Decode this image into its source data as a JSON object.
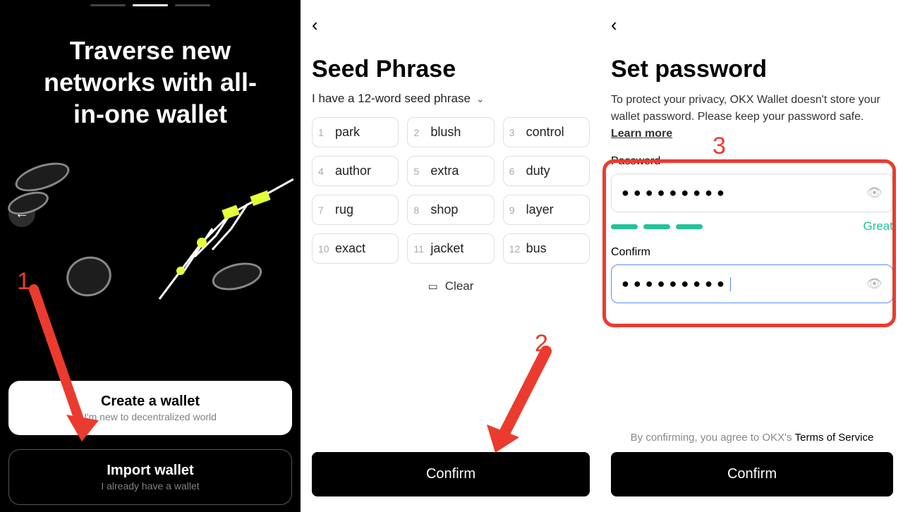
{
  "panel1": {
    "heading": "Traverse new networks with all-in-one wallet",
    "create_title": "Create a wallet",
    "create_sub": "I'm new to decentralized world",
    "import_title": "Import wallet",
    "import_sub": "I already have a wallet",
    "annotation_num": "1"
  },
  "panel2": {
    "title": "Seed Phrase",
    "selector": "I have a 12-word seed phrase",
    "words": [
      "park",
      "blush",
      "control",
      "author",
      "extra",
      "duty",
      "rug",
      "shop",
      "layer",
      "exact",
      "jacket",
      "bus"
    ],
    "clear_label": "Clear",
    "confirm_label": "Confirm",
    "annotation_num": "2"
  },
  "panel3": {
    "title": "Set password",
    "description": "To protect your privacy, OKX Wallet doesn't store your wallet password. Please keep your password safe.  ",
    "learn_more": "Learn more",
    "password_label": "Password",
    "password_mask": "●●●●●●●●●",
    "confirm_label": "Confirm",
    "confirm_mask": "●●●●●●●●●",
    "strength_label": "Great",
    "footer_prefix": "By confirming, you agree to OKX's ",
    "tos_label": "Terms of Service",
    "confirm_btn": "Confirm",
    "annotation_num": "3"
  }
}
